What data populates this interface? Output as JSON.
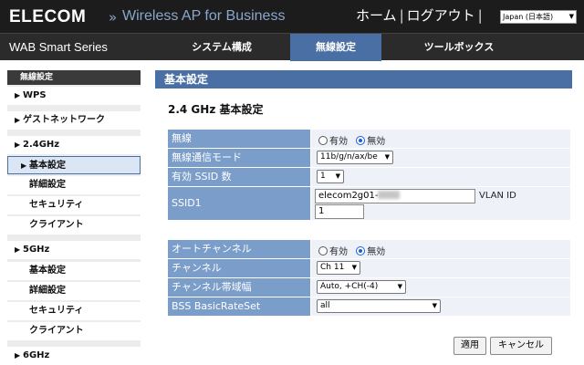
{
  "header": {
    "brand": "ELECOM",
    "chevron": "»",
    "product": "Wireless AP for Business",
    "home": "ホーム",
    "separator": "|",
    "logout": "ログアウト",
    "language": "Japan (日本語)"
  },
  "nav": {
    "series": "WAB Smart Series",
    "tabs": [
      {
        "label": "システム構成"
      },
      {
        "label": "無線設定"
      },
      {
        "label": "ツールボックス"
      }
    ],
    "active_tab": "無線設定",
    "accent_color": "#4a6fa5"
  },
  "sidebar": {
    "title": "無線設定",
    "items": [
      {
        "label": "WPS"
      },
      {
        "label": "ゲストネットワーク"
      },
      {
        "label": "2.4GHz"
      },
      {
        "label": "基本設定"
      },
      {
        "label": "詳細設定"
      },
      {
        "label": "セキュリティ"
      },
      {
        "label": "クライアント"
      },
      {
        "label": "5GHz"
      },
      {
        "label": "基本設定"
      },
      {
        "label": "詳細設定"
      },
      {
        "label": "セキュリティ"
      },
      {
        "label": "クライアント"
      },
      {
        "label": "6GHz"
      }
    ],
    "active_item": "基本設定"
  },
  "main": {
    "panel_title": "基本設定",
    "section_title": "2.4 GHz 基本設定",
    "wireless": {
      "label": "無線",
      "enabled": "有効",
      "disabled": "無効",
      "selected": "無効"
    },
    "mode": {
      "label": "無線通信モード",
      "value": "11b/g/n/ax/be"
    },
    "ssid_count": {
      "label": "有効 SSID 数",
      "value": "1"
    },
    "ssid1": {
      "label": "SSID1",
      "value": "elecom2g01-",
      "vlan_label": "VLAN ID",
      "vlan_value": "1"
    },
    "auto_channel": {
      "label": "オートチャンネル",
      "enabled": "有効",
      "disabled": "無効",
      "selected": "無効"
    },
    "channel": {
      "label": "チャンネル",
      "value": "Ch 11"
    },
    "bandwidth": {
      "label": "チャンネル帯域幅",
      "value": "Auto, +CH(-4)"
    },
    "bss_rate": {
      "label": "BSS BasicRateSet",
      "value": "all"
    },
    "apply_label": "適用",
    "cancel_label": "キャンセル"
  }
}
